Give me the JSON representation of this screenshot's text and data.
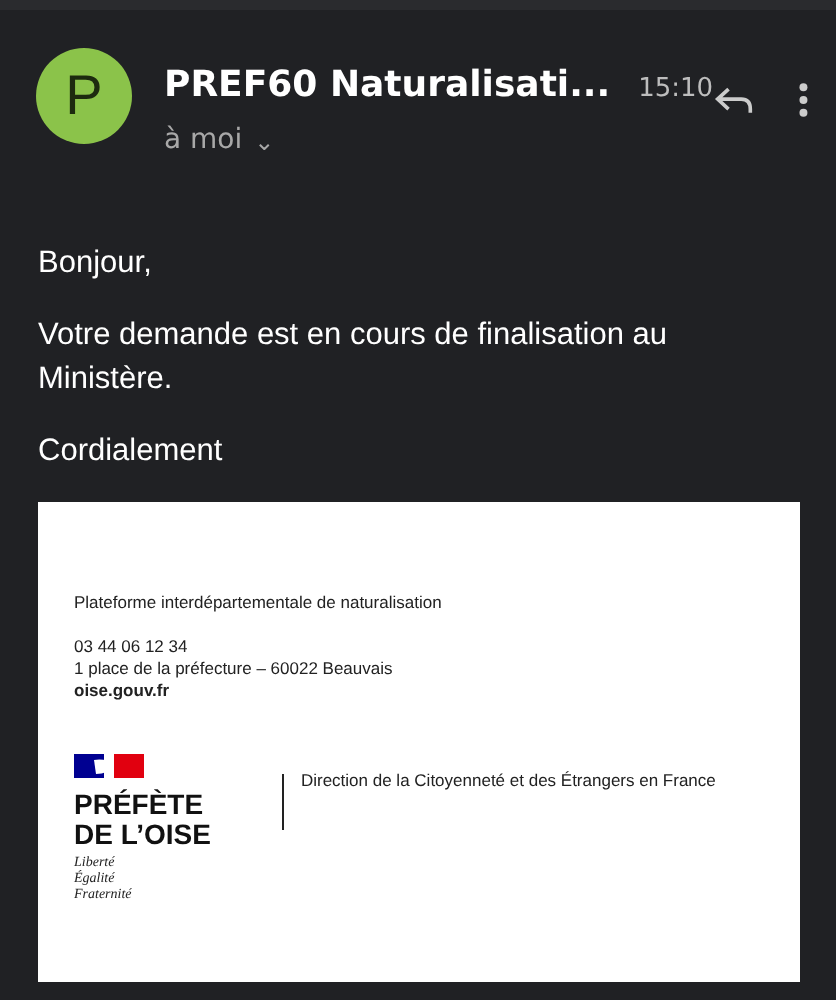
{
  "header": {
    "avatar_letter": "P",
    "sender": "PREF60 Naturalisati...",
    "time": "15:10",
    "recipient": "à moi",
    "chevron": "⌄"
  },
  "body": [
    "Bonjour,",
    "Votre demande est en cours de finalisation au Ministère.",
    "Cordialement"
  ],
  "letterhead": {
    "platform": "Plateforme interdépartementale de naturalisation",
    "phone": "03 44 06 12 34",
    "address": "1 place de la préfecture – 60022 Beauvais",
    "website": "oise.gouv.fr",
    "logo_lines": [
      "PRÉFÈTE",
      "DE L’OISE"
    ],
    "motto": [
      "Liberté",
      "Égalité",
      "Fraternité"
    ],
    "department": "Direction de la Citoyenneté et des Étrangers en France"
  }
}
